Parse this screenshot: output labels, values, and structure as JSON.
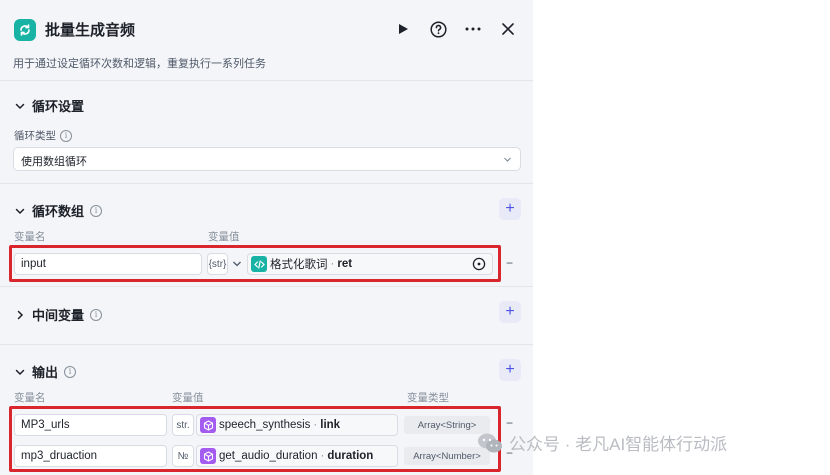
{
  "header": {
    "title": "批量生成音频",
    "description": "用于通过设定循环次数和逻辑，重复执行一系列任务"
  },
  "loop_settings": {
    "section_title": "循环设置",
    "type_label": "循环类型",
    "type_value": "使用数组循环"
  },
  "loop_array": {
    "section_title": "循环数组",
    "col_name": "变量名",
    "col_value": "变量值",
    "row": {
      "name": "input",
      "type_tag": "{str}",
      "ref_node": "格式化歌词",
      "ref_field": "ret"
    }
  },
  "intermediate": {
    "section_title": "中间变量"
  },
  "output": {
    "section_title": "输出",
    "col_name": "变量名",
    "col_value": "变量值",
    "col_type": "变量类型",
    "rows": [
      {
        "name": "MP3_urls",
        "type_tag": "str.",
        "ref_node": "speech_synthesis",
        "ref_field": "link",
        "var_type": "Array<String>"
      },
      {
        "name": "mp3_druaction",
        "type_tag": "№",
        "ref_node": "get_audio_duration",
        "ref_field": "duration",
        "var_type": "Array<Number>"
      }
    ]
  },
  "watermark": {
    "text": "公众号 · 老凡AI智能体行动派"
  },
  "colors": {
    "accent": "#4d53e8",
    "teal": "#19b3a6",
    "purple": "#a45bf0",
    "highlight": "#d9262c"
  }
}
